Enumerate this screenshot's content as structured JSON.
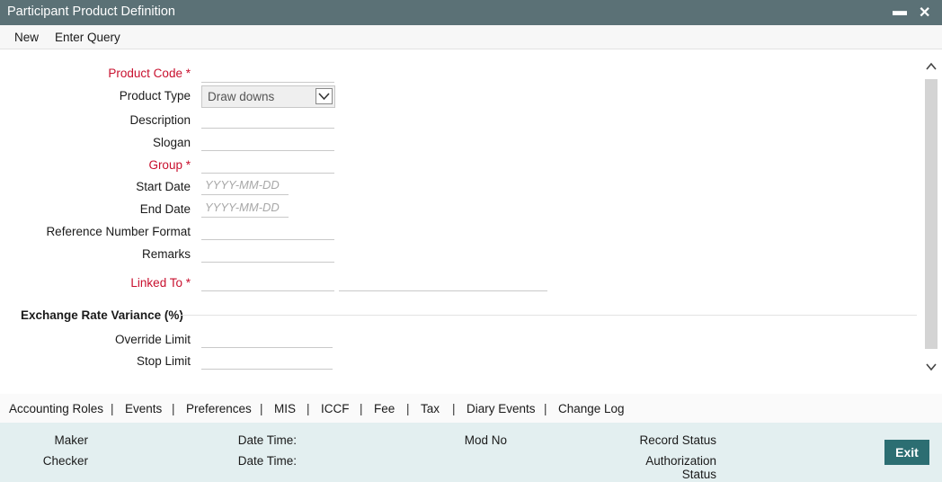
{
  "window": {
    "title": "Participant Product Definition",
    "minimize_glyph": "▬",
    "close_glyph": "✕"
  },
  "menu": {
    "new": "New",
    "enter_query": "Enter Query"
  },
  "form": {
    "product_code": {
      "label": "Product Code",
      "required": "*",
      "value": ""
    },
    "product_type": {
      "label": "Product Type",
      "value": "Draw downs"
    },
    "description": {
      "label": "Description",
      "value": ""
    },
    "slogan": {
      "label": "Slogan",
      "value": ""
    },
    "group": {
      "label": "Group",
      "required": "*",
      "value": ""
    },
    "start_date": {
      "label": "Start Date",
      "placeholder": "YYYY-MM-DD"
    },
    "end_date": {
      "label": "End Date",
      "placeholder": "YYYY-MM-DD"
    },
    "reference_number_format": {
      "label": "Reference Number Format",
      "value": ""
    },
    "remarks": {
      "label": "Remarks",
      "value": ""
    },
    "linked_to": {
      "label": "Linked To",
      "required": "*",
      "value": "",
      "description": ""
    }
  },
  "exchange_rate": {
    "title": "Exchange Rate Variance (%)",
    "override_limit": {
      "label": "Override Limit",
      "value": ""
    },
    "stop_limit": {
      "label": "Stop Limit",
      "value": ""
    }
  },
  "tabs": [
    "Accounting Roles",
    "Events",
    "Preferences",
    "MIS",
    "ICCF",
    "Fee",
    "Tax",
    "Diary Events",
    "Change Log"
  ],
  "tab_separator": "|",
  "footer": {
    "maker": "Maker",
    "checker": "Checker",
    "date_time_1": "Date Time:",
    "date_time_2": "Date Time:",
    "mod_no": "Mod No",
    "record_status": "Record Status",
    "authorization_status": "Authorization Status",
    "exit": "Exit"
  },
  "colors": {
    "titlebar": "#5b7176",
    "required": "#c8102e",
    "footer": "#e3eff0",
    "exit_button": "#2c6e72"
  },
  "icons": {
    "dropdown": "chevron-down-icon",
    "scroll_up": "chevron-up-icon",
    "scroll_down": "chevron-down-icon"
  }
}
